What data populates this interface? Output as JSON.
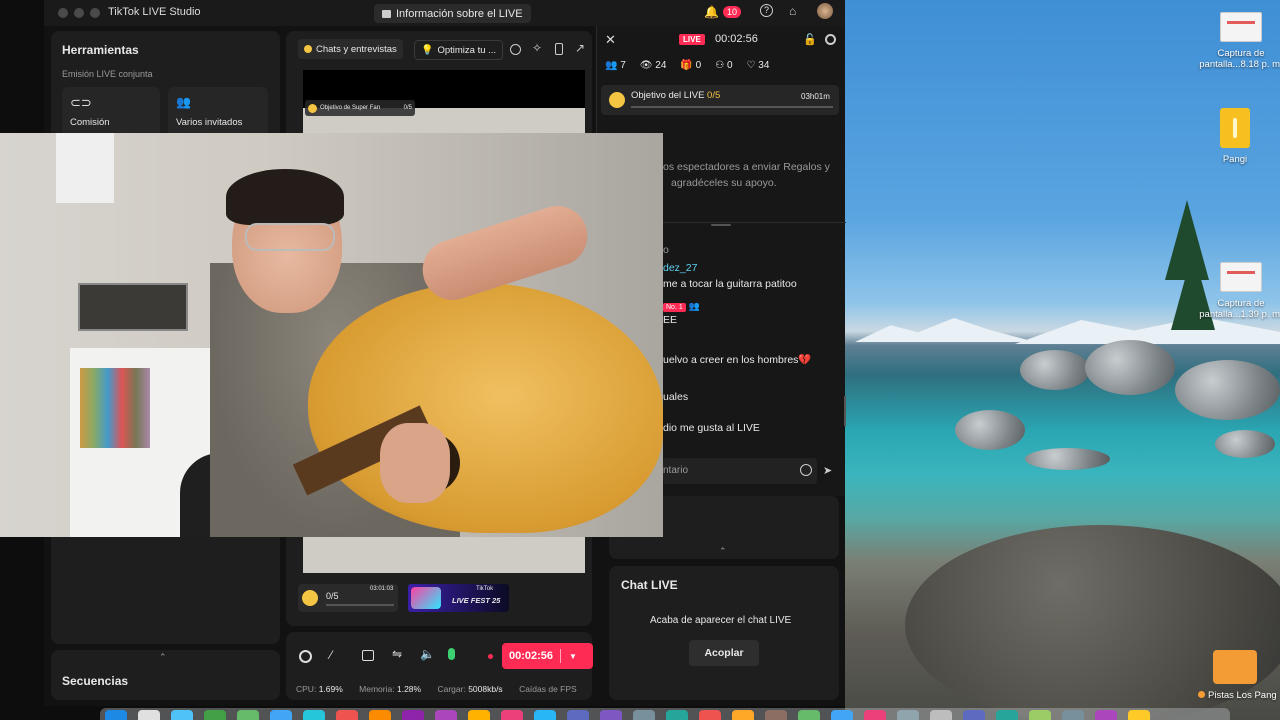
{
  "window": {
    "title": "TikTok LIVE Studio",
    "info_button": "Información sobre el LIVE",
    "notification_count": "10"
  },
  "tools": {
    "title": "Herramientas",
    "section": "Emisión LIVE conjunta",
    "coemision": "Comisión",
    "varios": "Varios invitados",
    "sequences": "Secuencias"
  },
  "preview": {
    "scene_tab": "Chats y entrevistas",
    "optimize": "Optimiza tu ...",
    "super_fan_goal": "Objetivo de Super Fan",
    "super_fan_count": "0/5",
    "goal_widget_count": "0/5",
    "goal_widget_time": "03:01:03",
    "banner_text": "LIVE FEST 25",
    "banner_brand": "TikTok"
  },
  "controls": {
    "timer": "00:02:56",
    "cpu_label": "CPU:",
    "cpu": "1.69%",
    "mem_label": "Memoria:",
    "mem": "1.28%",
    "load_label": "Cargar:",
    "load": "5008kb/s",
    "fps_label": "Caídas de FPS"
  },
  "live": {
    "badge": "LIVE",
    "timer": "00:02:56",
    "stats": {
      "users": "7",
      "views": "24",
      "gifts": "0",
      "follows": "0",
      "likes": "34"
    },
    "goal_title": "Objetivo del LIVE",
    "goal_count": "0/5",
    "goal_time": "03h01m",
    "tip_line1": "os espectadores a enviar Regalos y",
    "tip_line2": "agradéceles su apoyo.",
    "comment_placeholder": "ntario"
  },
  "chat": {
    "messages": [
      {
        "user": "dez_27",
        "text": "me a tocar la guitarra patitoo"
      },
      {
        "badge": "No. 1",
        "text": "EE"
      },
      {
        "text": "uelvo a creer en los hombres💔"
      },
      {
        "text": "uales"
      },
      {
        "text": "dio me gusta al LIVE"
      }
    ],
    "partial_top": "o"
  },
  "chat_live": {
    "title": "Chat LIVE",
    "message": "Acaba de aparecer el chat LIVE",
    "dock_button": "Acoplar"
  },
  "desktop": {
    "icons": [
      {
        "line1": "Captura de",
        "line2": "pantalla...8.18 p. m."
      },
      {
        "line1": "Pangi",
        "line2": ""
      },
      {
        "line1": "Captura de",
        "line2": "pantalla...1.39 p. m."
      },
      {
        "line1": "Pistas Los Pang",
        "line2": ""
      }
    ]
  },
  "colors": {
    "accent": "#fe2c55",
    "gold": "#f4c542",
    "live_pink": "#fe2c55"
  }
}
